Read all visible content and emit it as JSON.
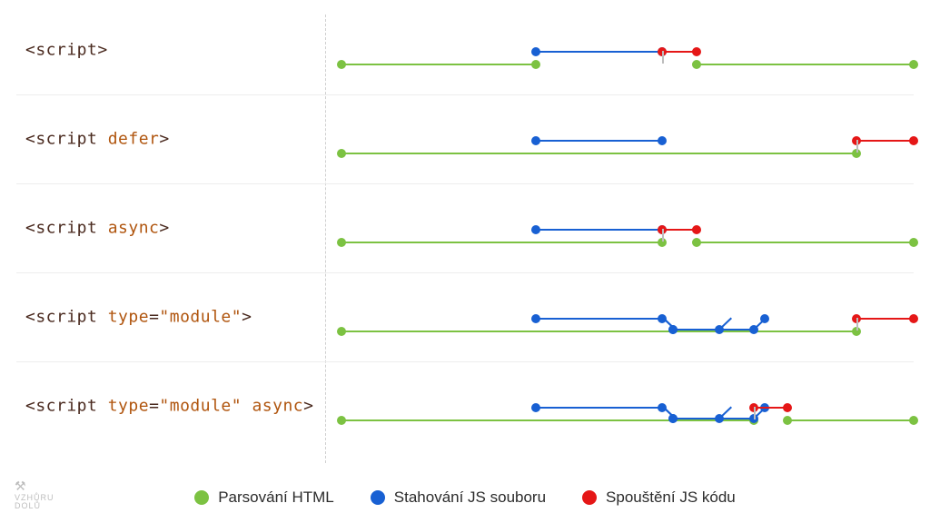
{
  "colors": {
    "green": "#7cc242",
    "blue": "#1860d3",
    "red": "#e51717"
  },
  "legend": {
    "parse": "Parsování HTML",
    "download": "Stahování JS souboru",
    "execute": "Spouštění JS kódu"
  },
  "logo": {
    "line1": "VZHŮRU",
    "line2": "DOLŮ"
  },
  "rows": [
    {
      "label_html": "&lt;script&gt;"
    },
    {
      "label_html": "&lt;script <span class=\"kw\">defer</span>&gt;"
    },
    {
      "label_html": "&lt;script <span class=\"kw\">async</span>&gt;"
    },
    {
      "label_html": "&lt;script <span class=\"kw\">type</span>=<span class=\"kw\">\"module\"</span>&gt;"
    },
    {
      "label_html": "&lt;script <span class=\"kw\">type</span>=<span class=\"kw\">\"module\"</span> <span class=\"kw\">async</span>&gt;"
    }
  ],
  "chart_data": {
    "type": "timeline",
    "x_range": [
      0,
      100
    ],
    "legend": [
      "Parsování HTML",
      "Stahování JS souboru",
      "Spouštění JS kódu"
    ],
    "variants": [
      {
        "name": "<script>",
        "parse": [
          [
            0,
            34
          ],
          [
            62,
            100
          ]
        ],
        "download": [
          [
            34,
            56
          ]
        ],
        "execute": [
          [
            56,
            62
          ]
        ]
      },
      {
        "name": "<script defer>",
        "parse": [
          [
            0,
            90
          ]
        ],
        "download": [
          [
            34,
            56
          ]
        ],
        "execute": [
          [
            90,
            100
          ]
        ]
      },
      {
        "name": "<script async>",
        "parse": [
          [
            0,
            56
          ],
          [
            62,
            100
          ]
        ],
        "download": [
          [
            34,
            56
          ]
        ],
        "execute": [
          [
            56,
            62
          ]
        ]
      },
      {
        "name": "<script type=\"module\">",
        "parse": [
          [
            0,
            90
          ]
        ],
        "download": [
          [
            34,
            56
          ]
        ],
        "module_deps": {
          "branch_at": 56,
          "deps": [
            [
              58,
              66
            ],
            [
              58,
              72
            ]
          ]
        },
        "execute": [
          [
            90,
            100
          ]
        ]
      },
      {
        "name": "<script type=\"module\" async>",
        "parse": [
          [
            0,
            72
          ],
          [
            78,
            100
          ]
        ],
        "download": [
          [
            34,
            56
          ]
        ],
        "module_deps": {
          "branch_at": 56,
          "deps": [
            [
              58,
              66
            ],
            [
              58,
              72
            ]
          ]
        },
        "execute": [
          [
            72,
            78
          ]
        ]
      }
    ]
  }
}
